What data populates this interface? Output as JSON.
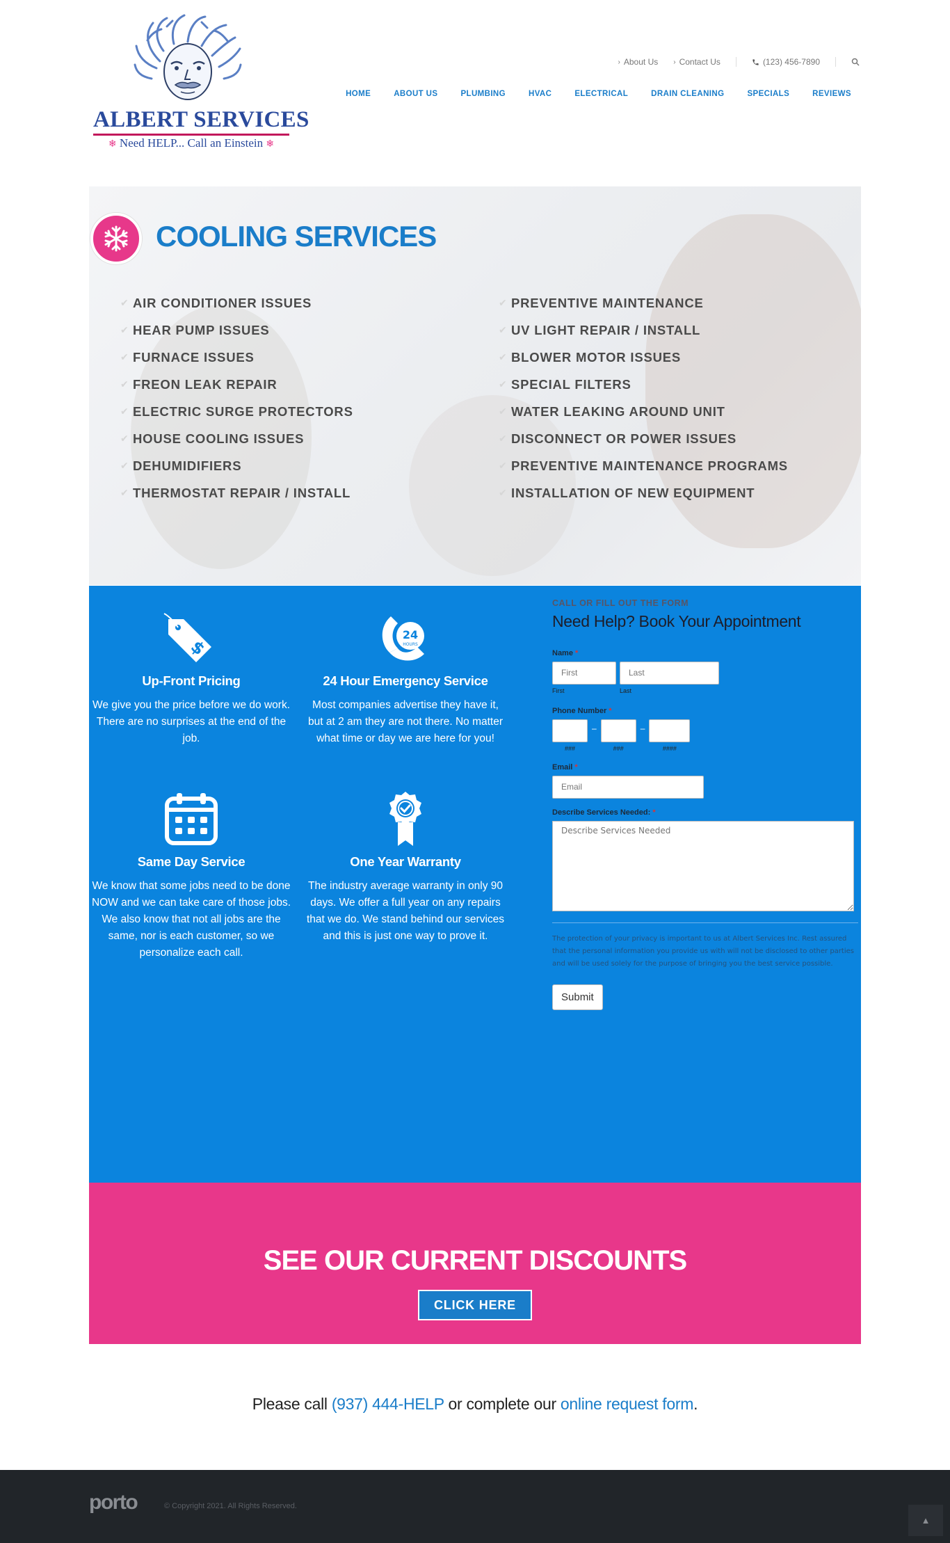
{
  "logo": {
    "name": "ALBERT SERVICES",
    "tagline": "Need HELP... Call an Einstein"
  },
  "toplinks": {
    "about": "About Us",
    "contact": "Contact Us",
    "phone": "(123) 456-7890"
  },
  "nav": {
    "items": [
      "HOME",
      "ABOUT US",
      "PLUMBING",
      "HVAC",
      "ELECTRICAL",
      "DRAIN CLEANING",
      "SPECIALS",
      "REVIEWS"
    ]
  },
  "cooling": {
    "title": "COOLING SERVICES",
    "left": [
      "AIR CONDITIONER ISSUES",
      "HEAR PUMP ISSUES",
      "FURNACE ISSUES",
      "FREON LEAK REPAIR",
      "ELECTRIC SURGE PROTECTORS",
      "HOUSE COOLING ISSUES",
      "DEHUMIDIFIERS",
      "THERMOSTAT REPAIR / INSTALL"
    ],
    "right": [
      "PREVENTIVE MAINTENANCE",
      "UV LIGHT REPAIR / INSTALL",
      "BLOWER MOTOR ISSUES",
      "SPECIAL FILTERS",
      "WATER LEAKING AROUND UNIT",
      "DISCONNECT OR POWER ISSUES",
      "PREVENTIVE MAINTENANCE PROGRAMS",
      "INSTALLATION OF NEW EQUIPMENT"
    ]
  },
  "features": [
    {
      "title": "Up-Front Pricing",
      "text": "We give you the price before we do work. There are no surprises at the end of the job."
    },
    {
      "title": "24 Hour Emergency Service",
      "text": "Most companies advertise they have it, but at 2 am they are not there. No matter what time or day we are here for you!",
      "icon_text": "24",
      "icon_sub": "HOURS"
    },
    {
      "title": "Same Day Service",
      "text": "We know that some jobs need to be done NOW and we can take care of those jobs. We also know that not all jobs are the same, nor is each customer, so we personalize each call."
    },
    {
      "title": "One Year Warranty",
      "text": "The industry average warranty in only 90 days. We offer a full year on any repairs that we do. We stand behind our services and this is just one way to prove it."
    }
  ],
  "form": {
    "eyebrow": "CALL OR FILL OUT THE FORM",
    "title": "Need Help? Book Your Appointment",
    "name_label": "Name",
    "first_placeholder": "First",
    "last_placeholder": "Last",
    "first_sub": "First",
    "last_sub": "Last",
    "phone_label": "Phone Number",
    "phone_sub1": "###",
    "phone_sub2": "###",
    "phone_sub3": "####",
    "email_label": "Email",
    "email_placeholder": "Email",
    "describe_label": "Describe Services Needed:",
    "describe_placeholder": "Describe Services Needed",
    "required_mark": "*",
    "privacy": "The protection of your privacy is important to us at Albert Services Inc. Rest assured that the personal information you provide us with will not be disclosed to other parties and will be used solely for the purpose of bringing you the best service possible.",
    "submit": "Submit"
  },
  "discounts": {
    "title": "SEE OUR CURRENT DISCOUNTS",
    "button": "CLICK HERE"
  },
  "callline": {
    "prefix": "Please call",
    "phone": "(937) 444-HELP",
    "middle": "or complete our",
    "link": "online request form",
    "suffix": "."
  },
  "footer": {
    "brand": "porto",
    "copyright": "© Copyright 2021. All Rights Reserved."
  },
  "colors": {
    "blue": "#0b84de",
    "pink": "#e8378a",
    "nav_blue": "#1a7dc9",
    "footer": "#212529"
  }
}
